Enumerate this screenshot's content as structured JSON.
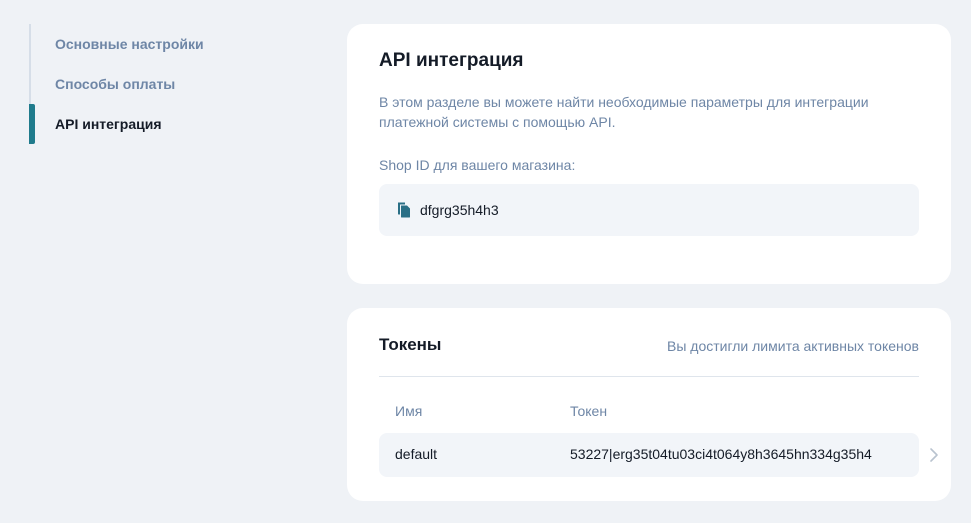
{
  "sidebar": {
    "items": [
      {
        "label": "Основные настройки",
        "active": false
      },
      {
        "label": "Способы оплаты",
        "active": false
      },
      {
        "label": "API интеграция",
        "active": true
      }
    ]
  },
  "api_card": {
    "title": "API интеграция",
    "description": "В этом разделе вы можете найти необходимые параметры для интеграции платежной системы с помощью API.",
    "shop_id_label": "Shop ID для вашего магазина:",
    "shop_id": "dfgrg35h4h3"
  },
  "tokens_card": {
    "title": "Токены",
    "limit_notice": "Вы достигли лимита активных токенов",
    "columns": {
      "name": "Имя",
      "token": "Токен"
    },
    "rows": [
      {
        "name": "default",
        "token": "53227|erg35t04tu03ci4t064y8h3645hn334g35h4"
      }
    ]
  },
  "colors": {
    "accent": "#1f7b8c",
    "muted_text": "#6e86a6",
    "background": "#eff2f6"
  },
  "icons": {
    "copy": "copy-icon",
    "chevron": "chevron-right-icon"
  }
}
